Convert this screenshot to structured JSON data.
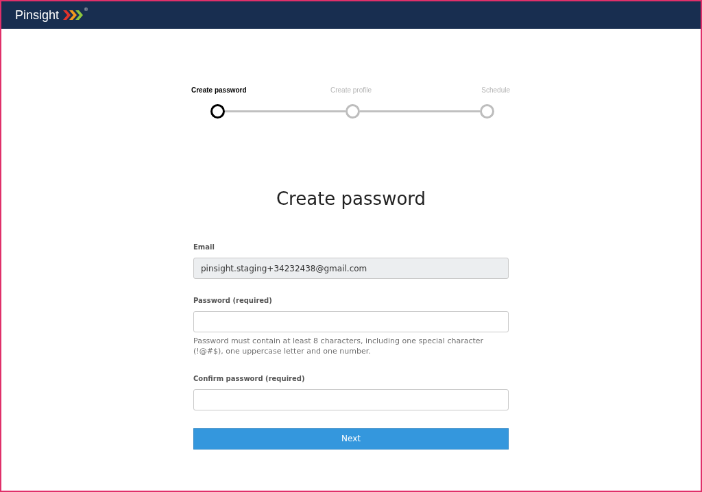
{
  "header": {
    "logo_text": "Pinsight",
    "logo_mark": "®"
  },
  "steps": [
    {
      "label": "Create password",
      "selected": true
    },
    {
      "label": "Create profile",
      "selected": false
    },
    {
      "label": "Schedule",
      "selected": false
    }
  ],
  "title": "Create password",
  "fields": [
    {
      "label": "Email",
      "value": "pinsight.staging+34232438@gmail.com",
      "disabled": true
    },
    {
      "label": "Password (required)",
      "disabled": false,
      "hint": "Password must contain at least 8 characters, including one special character (!@#$), one uppercase letter and one number."
    },
    {
      "label": "Confirm password (required)",
      "disabled": false
    }
  ],
  "submit": "Next"
}
